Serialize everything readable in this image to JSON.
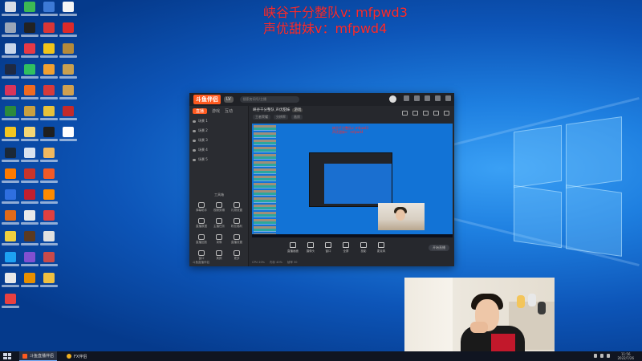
{
  "overlay": {
    "line1": "峡谷千分整队v: mfpwd3",
    "line2": "声优甜妹v：mfpwd4"
  },
  "app": {
    "logo_text": "斗鱼伴侣",
    "badge": "LV",
    "search_placeholder": "搜索房间号/主播",
    "tabs": [
      "直播",
      "游戏",
      "互动"
    ],
    "scenes": [
      "场景 1",
      "场景 2",
      "场景 3",
      "场景 4",
      "场景 5"
    ],
    "toolbox_title": "工具箱",
    "tools": [
      "弹幕助手",
      "视频剪辑",
      "礼物设置",
      "直播数据",
      "主播任务",
      "粉丝福利",
      "直播回放",
      "录像",
      "直播设置",
      "窗口",
      "美颜",
      "更多"
    ],
    "footer": "斗鱼直播伴侣",
    "room_title": "峡谷千分整队 声优甜妹",
    "room_tag": "游戏",
    "room_sub": [
      "王者荣耀",
      "分辨率",
      "画质"
    ],
    "preview_red_lines": [
      "峡谷千分整队v: mfpwd3",
      "声优甜妹v：mfpwd4"
    ],
    "controls": [
      "直播画面",
      "摄像头",
      "窗口",
      "全屏",
      "投影",
      "麦克风"
    ],
    "go_live": "开始直播",
    "status": [
      "CPU 20%",
      "内存 40%",
      "帧率 30"
    ]
  },
  "taskbar": {
    "apps": [
      {
        "label": "斗鱼直播伴侣",
        "color": "#ff5a1f"
      },
      {
        "label": "FX伴侣",
        "color": "#f0b020"
      }
    ],
    "time": "11:56",
    "date": "2022/7/26"
  },
  "colors": {
    "overlay_text": "#ff2a2a",
    "accent": "#ff5a1f",
    "wallpaper": "#0d55b8"
  }
}
